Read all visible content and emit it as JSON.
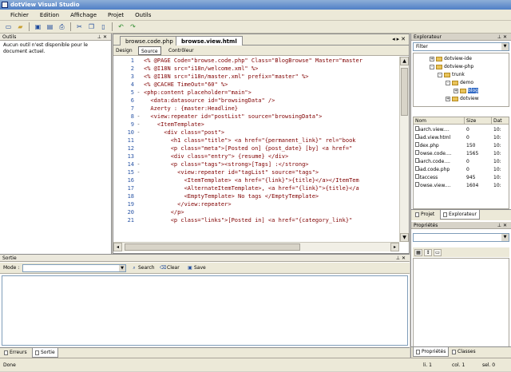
{
  "window": {
    "title": "dotView Visual Studio"
  },
  "menu": [
    "Fichier",
    "Edition",
    "Affichage",
    "Projet",
    "Outils"
  ],
  "toolbar": {
    "icons": [
      "new-file-icon",
      "open-folder-icon",
      "save-icon",
      "save-all-icon",
      "print-icon",
      "cut-icon",
      "copy-icon",
      "paste-icon",
      "undo-icon",
      "redo-icon"
    ]
  },
  "outils": {
    "title": "Outils",
    "message": "Aucun outil n'est disponible pour le document actuel."
  },
  "editor": {
    "tabs": [
      {
        "label": "browse.code.php"
      },
      {
        "label": "browse.view.html"
      }
    ],
    "view_tabs": [
      {
        "label": "Design"
      },
      {
        "label": "Source"
      },
      {
        "label": "Contrôleur"
      }
    ],
    "lines": [
      {
        "n": "1",
        "mark": "",
        "text": "<% @PAGE Code=\"browse.code.php\" Class=\"BlogBrowse\" Master=\"master"
      },
      {
        "n": "2",
        "mark": "",
        "text": "<% @I18N src=\"i18n/welcome.xml\" %>"
      },
      {
        "n": "3",
        "mark": "",
        "text": "<% @I18N src=\"i18n/master.xml\" prefix=\"master\" %>"
      },
      {
        "n": "4",
        "mark": "",
        "text": "<% @CACHE TimeOut=\"60\" %>"
      },
      {
        "n": "5",
        "mark": "-",
        "text": "<php:content placeholder=\"main\">"
      },
      {
        "n": "6",
        "mark": "",
        "text": "  <data:datasource id=\"browsingData\" />"
      },
      {
        "n": "7",
        "mark": "",
        "text": "  Azerty : {master:Headline}"
      },
      {
        "n": "8",
        "mark": "-",
        "text": "  <view:repeater id=\"postList\" source=\"browsingData\">"
      },
      {
        "n": "9",
        "mark": "-",
        "text": "    <ItemTemplate>"
      },
      {
        "n": "10",
        "mark": "-",
        "text": "      <div class=\"post\">"
      },
      {
        "n": "11",
        "mark": "",
        "text": "        <h1 class=\"title\"> <a href=\"{permanent_link}\" rel=\"book"
      },
      {
        "n": "12",
        "mark": "",
        "text": "        <p class=\"meta\">[Posted on] {post_date} [by] <a href=\""
      },
      {
        "n": "13",
        "mark": "",
        "text": "        <div class=\"entry\"> {resume} </div>"
      },
      {
        "n": "14",
        "mark": "-",
        "text": "        <p class=\"tags\"><strong>[Tags] :</strong>"
      },
      {
        "n": "15",
        "mark": "-",
        "text": "          <view:repeater id=\"tagList\" source=\"tags\">"
      },
      {
        "n": "16",
        "mark": "",
        "text": "            <ItemTemplate> <a href=\"{link}\">{title}</a></ItemTem"
      },
      {
        "n": "17",
        "mark": "",
        "text": "            <AlternateItemTemplate>, <a href=\"{link}\">{title}</a"
      },
      {
        "n": "18",
        "mark": "",
        "text": "            <EmptyTemplate> No tags </EmptyTemplate>"
      },
      {
        "n": "19",
        "mark": "",
        "text": "          </view:repeater>"
      },
      {
        "n": "20",
        "mark": "",
        "text": "        </p>"
      },
      {
        "n": "21",
        "mark": "",
        "text": "        <p class=\"links\">[Posted in] <a href=\"{category_link}\""
      }
    ]
  },
  "explorer": {
    "title": "Explorateur",
    "filter": "Filter",
    "tree": [
      {
        "label": "dotview-ide",
        "depth": 1,
        "expander": "+"
      },
      {
        "label": "dotview-php",
        "depth": 1,
        "expander": "-"
      },
      {
        "label": "trunk",
        "depth": 2,
        "expander": "-"
      },
      {
        "label": "demo",
        "depth": 3,
        "expander": "-"
      },
      {
        "label": "blog",
        "depth": 4,
        "expander": "+",
        "selected": true
      },
      {
        "label": "dotview",
        "depth": 3,
        "expander": "+"
      }
    ],
    "columns": [
      "Nom",
      "Size",
      "Dat"
    ],
    "files": [
      {
        "name": "search.view....",
        "size": "0",
        "date": "10:"
      },
      {
        "name": "read.view.html",
        "size": "0",
        "date": "10:"
      },
      {
        "name": "index.php",
        "size": "150",
        "date": "10:"
      },
      {
        "name": "browse.code....",
        "size": "1565",
        "date": "10:"
      },
      {
        "name": "search.code....",
        "size": "0",
        "date": "10:"
      },
      {
        "name": "read.code.php",
        "size": "0",
        "date": "10:"
      },
      {
        "name": ".htaccess",
        "size": "945",
        "date": "10:"
      },
      {
        "name": "browse.view....",
        "size": "1604",
        "date": "10:"
      }
    ],
    "tabs": [
      {
        "label": "Projet"
      },
      {
        "label": "Explorateur"
      }
    ]
  },
  "properties": {
    "title": "Propriétés",
    "tabs": [
      {
        "label": "Propriétés"
      },
      {
        "label": "Classes"
      }
    ]
  },
  "sortie": {
    "title": "Sortie",
    "mode_label": "Mode :",
    "mode_value": "",
    "search_label": "Search",
    "clear_label": "Clear",
    "save_label": "Save",
    "tabs": [
      {
        "label": "Erreurs"
      },
      {
        "label": "Sortie"
      }
    ]
  },
  "status": {
    "text": "Done",
    "line": "li. 1",
    "col": "col. 1",
    "sel": "sel. 0"
  }
}
